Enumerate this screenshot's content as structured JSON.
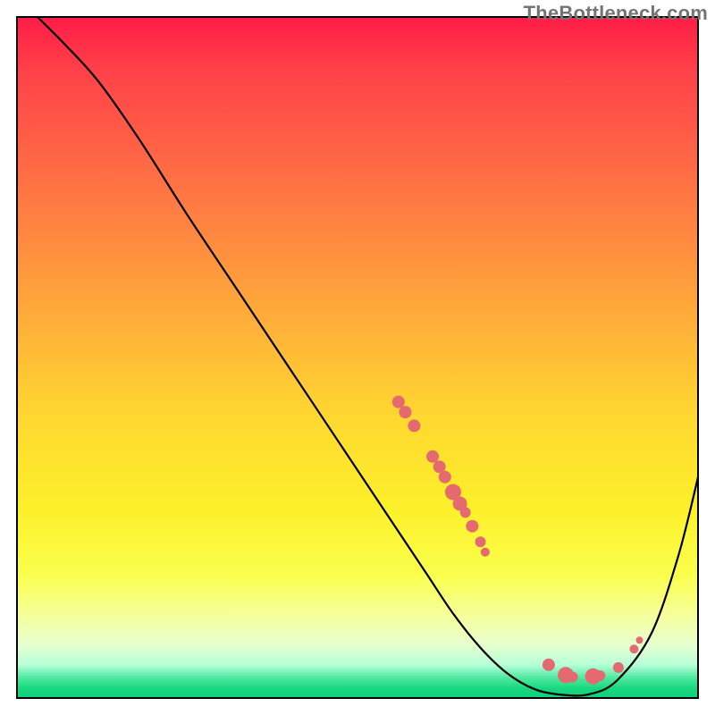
{
  "watermark": "TheBottleneck.com",
  "chart_data": {
    "type": "line",
    "title": "",
    "xlabel": "",
    "ylabel": "",
    "xlim": [
      0,
      100
    ],
    "ylim": [
      0,
      100
    ],
    "gradient_stops": [
      {
        "pos": 0,
        "color": "#ff1c47"
      },
      {
        "pos": 8,
        "color": "#ff4149"
      },
      {
        "pos": 22,
        "color": "#ff6a45"
      },
      {
        "pos": 40,
        "color": "#ffa03c"
      },
      {
        "pos": 58,
        "color": "#ffd631"
      },
      {
        "pos": 72,
        "color": "#fdf02a"
      },
      {
        "pos": 82,
        "color": "#faff4e"
      },
      {
        "pos": 88,
        "color": "#f5ff9e"
      },
      {
        "pos": 92,
        "color": "#e8ffce"
      },
      {
        "pos": 95,
        "color": "#b6ffd8"
      },
      {
        "pos": 97,
        "color": "#4be89e"
      },
      {
        "pos": 98.5,
        "color": "#17d87e"
      },
      {
        "pos": 100,
        "color": "#0fcf78"
      }
    ],
    "series": [
      {
        "name": "bottleneck-curve",
        "color": "#000000",
        "stroke_width": 2.2,
        "x": [
          3,
          7,
          12,
          18,
          25,
          32,
          40,
          48,
          55,
          60,
          64,
          68,
          72,
          76,
          80,
          84,
          88,
          93,
          97,
          100
        ],
        "y": [
          100,
          96,
          90.5,
          82,
          71,
          60.5,
          48.5,
          36.5,
          26,
          18.5,
          12.5,
          7.5,
          3.7,
          1.4,
          0.6,
          0.7,
          2.7,
          9.5,
          21,
          33
        ]
      }
    ],
    "markers": {
      "color": "#e46a6f",
      "points": [
        {
          "x": 56,
          "y": 43.5,
          "r": 7
        },
        {
          "x": 57,
          "y": 42,
          "r": 7
        },
        {
          "x": 58.3,
          "y": 40,
          "r": 7
        },
        {
          "x": 61,
          "y": 35.5,
          "r": 7
        },
        {
          "x": 62,
          "y": 34,
          "r": 7
        },
        {
          "x": 62.8,
          "y": 32.5,
          "r": 7
        },
        {
          "x": 64,
          "y": 30.3,
          "r": 9
        },
        {
          "x": 65,
          "y": 28.6,
          "r": 8
        },
        {
          "x": 65.8,
          "y": 27.3,
          "r": 6
        },
        {
          "x": 66.8,
          "y": 25.3,
          "r": 7
        },
        {
          "x": 68,
          "y": 23,
          "r": 6
        },
        {
          "x": 68.7,
          "y": 21.5,
          "r": 5
        },
        {
          "x": 78,
          "y": 5.0,
          "r": 7
        },
        {
          "x": 80.5,
          "y": 3.5,
          "r": 9
        },
        {
          "x": 81.5,
          "y": 3.2,
          "r": 6
        },
        {
          "x": 84.5,
          "y": 3.3,
          "r": 9
        },
        {
          "x": 85.5,
          "y": 3.4,
          "r": 6
        },
        {
          "x": 88.2,
          "y": 4.6,
          "r": 6
        },
        {
          "x": 90.5,
          "y": 7.3,
          "r": 5
        },
        {
          "x": 91.3,
          "y": 8.6,
          "r": 4
        }
      ]
    }
  }
}
